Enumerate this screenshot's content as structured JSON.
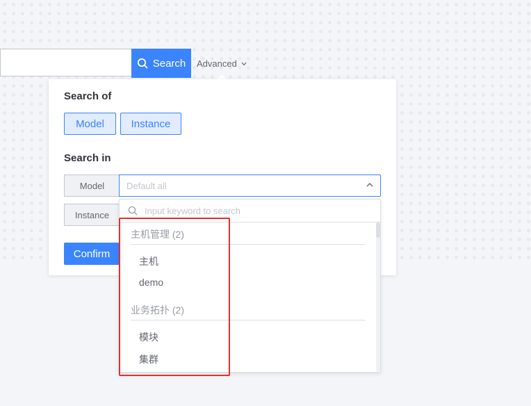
{
  "search_bar": {
    "input_value": "",
    "button_label": "Search",
    "advanced_label": "Advanced"
  },
  "panel": {
    "search_of_title": "Search of",
    "toggles": [
      "Model",
      "Instance"
    ],
    "search_in_title": "Search in",
    "model_label": "Model",
    "model_placeholder": "Default all",
    "instance_label": "Instance",
    "confirm_label": "Confirm"
  },
  "dropdown": {
    "search_placeholder": "Input keyword to search",
    "groups": [
      {
        "title": "主机管理 (2)",
        "options": [
          "主机",
          "demo"
        ]
      },
      {
        "title": "业务拓扑 (2)",
        "options": [
          "模块",
          "集群"
        ]
      }
    ]
  },
  "colors": {
    "accent": "#3a84ff",
    "highlight": "#e62e2e",
    "background": "#f4f5f8"
  }
}
